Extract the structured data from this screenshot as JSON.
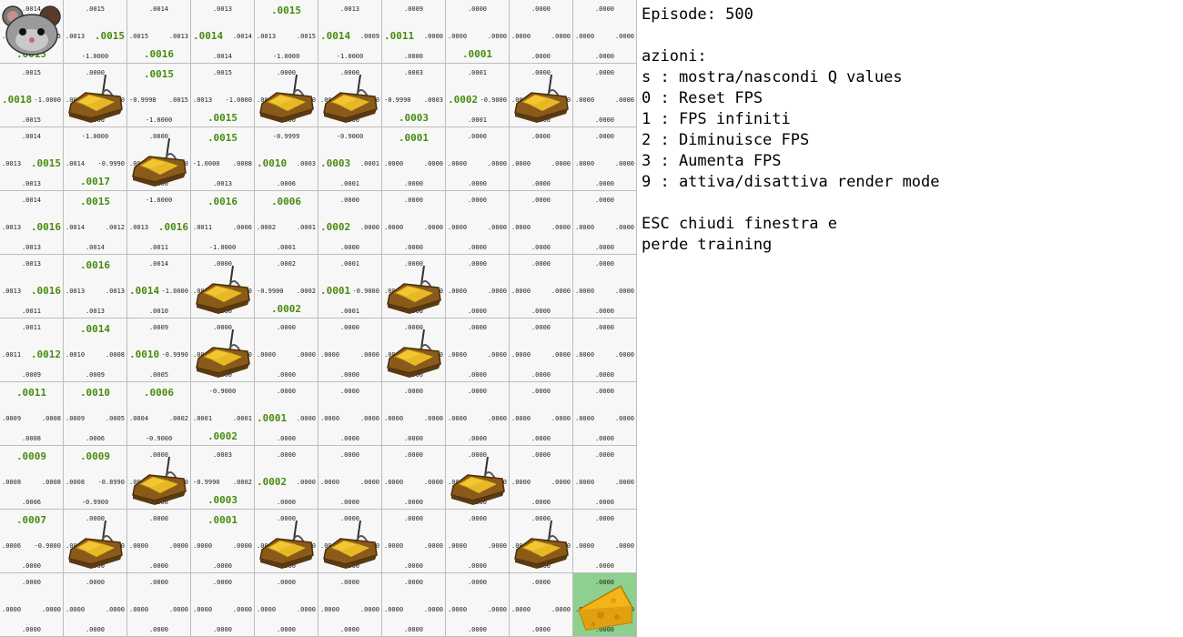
{
  "window": {
    "title": ""
  },
  "grid": {
    "rows": 10,
    "cols": 10,
    "agent": {
      "row": 0,
      "col": 0,
      "icon": "mouse-icon"
    },
    "goal": {
      "row": 9,
      "col": 9,
      "icon": "cheese-icon",
      "color": "#8fd08f"
    },
    "traps": [
      [
        1,
        1
      ],
      [
        1,
        4
      ],
      [
        1,
        5
      ],
      [
        1,
        8
      ],
      [
        2,
        2
      ],
      [
        4,
        3
      ],
      [
        4,
        6
      ],
      [
        5,
        3
      ],
      [
        5,
        6
      ],
      [
        7,
        2
      ],
      [
        7,
        7
      ],
      [
        8,
        1
      ],
      [
        8,
        4
      ],
      [
        8,
        5
      ],
      [
        8,
        8
      ]
    ],
    "trap_icon": "mousetrap-icon",
    "best_color": "#4a8a10",
    "cells": [
      [
        {
          "up": ".0014",
          "left": ".0014",
          "right": ".0015",
          "down": ".0015",
          "best": "down"
        },
        {
          "up": ".0015",
          "left": ".0013",
          "right": ".0015",
          "down": "-1.0000",
          "best": "right"
        },
        {
          "up": ".0014",
          "left": ".0015",
          "right": ".0013",
          "down": ".0016",
          "best": "down"
        },
        {
          "up": ".0013",
          "left": ".0014",
          "right": ".0014",
          "down": ".0014",
          "best": "left"
        },
        {
          "up": ".0015",
          "left": ".0013",
          "right": ".0015",
          "down": "-1.0000",
          "best": "up"
        },
        {
          "up": ".0013",
          "left": ".0014",
          "right": ".0009",
          "down": "-1.0000",
          "best": "left"
        },
        {
          "up": ".0009",
          "left": ".0011",
          "right": ".0000",
          "down": ".0000",
          "best": "left"
        },
        {
          "up": ".0000",
          "left": ".0000",
          "right": ".0000",
          "down": ".0001",
          "best": "down"
        },
        {
          "up": ".0000",
          "left": ".0000",
          "right": ".0000",
          "down": ".0000",
          "best": ""
        },
        {
          "up": ".0000",
          "left": ".0000",
          "right": ".0000",
          "down": ".0000",
          "best": ""
        }
      ],
      [
        {
          "up": ".0015",
          "left": ".0018",
          "right": "-1.0000",
          "down": ".0015",
          "best": "left"
        },
        {
          "up": ".0000",
          "left": ".0000",
          "right": ".0000",
          "down": ".0000",
          "best": ""
        },
        {
          "up": ".0015",
          "left": "-0.9998",
          "right": ".0015",
          "down": "-1.0000",
          "best": "up"
        },
        {
          "up": ".0015",
          "left": ".0013",
          "right": "-1.0000",
          "down": ".0015",
          "best": "down"
        },
        {
          "up": ".0000",
          "left": ".0000",
          "right": ".0000",
          "down": ".0000",
          "best": ""
        },
        {
          "up": ".0000",
          "left": ".0000",
          "right": ".0000",
          "down": ".0000",
          "best": ""
        },
        {
          "up": ".0003",
          "left": "-0.9990",
          "right": ".0003",
          "down": ".0003",
          "best": "down"
        },
        {
          "up": ".0001",
          "left": ".0002",
          "right": "-0.9000",
          "down": ".0001",
          "best": "left"
        },
        {
          "up": ".0000",
          "left": ".0000",
          "right": ".0000",
          "down": ".0000",
          "best": ""
        },
        {
          "up": ".0000",
          "left": ".0000",
          "right": ".0000",
          "down": ".0000",
          "best": ""
        }
      ],
      [
        {
          "up": ".0014",
          "left": ".0013",
          "right": ".0015",
          "down": ".0013",
          "best": "right"
        },
        {
          "up": "-1.0000",
          "left": ".0014",
          "right": "-0.9990",
          "down": ".0017",
          "best": "down"
        },
        {
          "up": ".0000",
          "left": ".0000",
          "right": ".0000",
          "down": ".0000",
          "best": ""
        },
        {
          "up": ".0015",
          "left": "-1.0000",
          "right": ".0008",
          "down": ".0013",
          "best": "up"
        },
        {
          "up": "-0.9999",
          "left": ".0010",
          "right": ".0003",
          "down": ".0006",
          "best": "left"
        },
        {
          "up": "-0.9000",
          "left": ".0003",
          "right": ".0001",
          "down": ".0001",
          "best": "left"
        },
        {
          "up": ".0001",
          "left": ".0000",
          "right": ".0000",
          "down": ".0000",
          "best": "up"
        },
        {
          "up": ".0000",
          "left": ".0000",
          "right": ".0000",
          "down": ".0000",
          "best": ""
        },
        {
          "up": ".0000",
          "left": ".0000",
          "right": ".0000",
          "down": ".0000",
          "best": ""
        },
        {
          "up": ".0000",
          "left": ".0000",
          "right": ".0000",
          "down": ".0000",
          "best": ""
        }
      ],
      [
        {
          "up": ".0014",
          "left": ".0013",
          "right": ".0016",
          "down": ".0013",
          "best": "right"
        },
        {
          "up": ".0015",
          "left": ".0014",
          "right": ".0012",
          "down": ".0014",
          "best": "up"
        },
        {
          "up": "-1.0000",
          "left": ".0013",
          "right": ".0016",
          "down": ".0011",
          "best": "right"
        },
        {
          "up": ".0016",
          "left": ".0011",
          "right": ".0006",
          "down": "-1.0000",
          "best": "up"
        },
        {
          "up": ".0006",
          "left": ".0002",
          "right": ".0001",
          "down": ".0001",
          "best": "up"
        },
        {
          "up": ".0000",
          "left": ".0002",
          "right": ".0000",
          "down": ".0000",
          "best": "left"
        },
        {
          "up": ".0000",
          "left": ".0000",
          "right": ".0000",
          "down": ".0000",
          "best": ""
        },
        {
          "up": ".0000",
          "left": ".0000",
          "right": ".0000",
          "down": ".0000",
          "best": ""
        },
        {
          "up": ".0000",
          "left": ".0000",
          "right": ".0000",
          "down": ".0000",
          "best": ""
        },
        {
          "up": ".0000",
          "left": ".0000",
          "right": ".0000",
          "down": ".0000",
          "best": ""
        }
      ],
      [
        {
          "up": ".0013",
          "left": ".0013",
          "right": ".0016",
          "down": ".0011",
          "best": "right"
        },
        {
          "up": ".0016",
          "left": ".0013",
          "right": ".0013",
          "down": ".0013",
          "best": "up"
        },
        {
          "up": ".0014",
          "left": ".0014",
          "right": "-1.0000",
          "down": ".0010",
          "best": "left"
        },
        {
          "up": ".0000",
          "left": ".0000",
          "right": ".0000",
          "down": ".0000",
          "best": ""
        },
        {
          "up": ".0002",
          "left": "-0.9900",
          "right": ".0002",
          "down": ".0002",
          "best": "down"
        },
        {
          "up": ".0001",
          "left": ".0001",
          "right": "-0.9000",
          "down": ".0001",
          "best": "left"
        },
        {
          "up": ".0000",
          "left": ".0000",
          "right": ".0000",
          "down": ".0000",
          "best": ""
        },
        {
          "up": ".0000",
          "left": ".0000",
          "right": ".0000",
          "down": ".0000",
          "best": ""
        },
        {
          "up": ".0000",
          "left": ".0000",
          "right": ".0000",
          "down": ".0000",
          "best": ""
        },
        {
          "up": ".0000",
          "left": ".0000",
          "right": ".0000",
          "down": ".0000",
          "best": ""
        }
      ],
      [
        {
          "up": ".0011",
          "left": ".0011",
          "right": ".0012",
          "down": ".0009",
          "best": "right"
        },
        {
          "up": ".0014",
          "left": ".0010",
          "right": ".0008",
          "down": ".0009",
          "best": "up"
        },
        {
          "up": ".0009",
          "left": ".0010",
          "right": "-0.9990",
          "down": ".0005",
          "best": "left"
        },
        {
          "up": ".0000",
          "left": ".0000",
          "right": ".0000",
          "down": ".0000",
          "best": ""
        },
        {
          "up": ".0000",
          "left": ".0000",
          "right": ".0000",
          "down": ".0000",
          "best": ""
        },
        {
          "up": ".0000",
          "left": ".0000",
          "right": ".0000",
          "down": ".0000",
          "best": ""
        },
        {
          "up": ".0000",
          "left": ".0000",
          "right": ".0000",
          "down": ".0000",
          "best": ""
        },
        {
          "up": ".0000",
          "left": ".0000",
          "right": ".0000",
          "down": ".0000",
          "best": ""
        },
        {
          "up": ".0000",
          "left": ".0000",
          "right": ".0000",
          "down": ".0000",
          "best": ""
        },
        {
          "up": ".0000",
          "left": ".0000",
          "right": ".0000",
          "down": ".0000",
          "best": ""
        }
      ],
      [
        {
          "up": ".0011",
          "left": ".0009",
          "right": ".0008",
          "down": ".0008",
          "best": "up"
        },
        {
          "up": ".0010",
          "left": ".0009",
          "right": ".0005",
          "down": ".0006",
          "best": "up"
        },
        {
          "up": ".0006",
          "left": ".0004",
          "right": ".0002",
          "down": "-0.9000",
          "best": "up"
        },
        {
          "up": "-0.9000",
          "left": ".0001",
          "right": ".0001",
          "down": ".0002",
          "best": "down"
        },
        {
          "up": ".0000",
          "left": ".0001",
          "right": ".0000",
          "down": ".0000",
          "best": "left"
        },
        {
          "up": ".0000",
          "left": ".0000",
          "right": ".0000",
          "down": ".0000",
          "best": ""
        },
        {
          "up": ".0000",
          "left": ".0000",
          "right": ".0000",
          "down": ".0000",
          "best": ""
        },
        {
          "up": ".0000",
          "left": ".0000",
          "right": ".0000",
          "down": ".0000",
          "best": ""
        },
        {
          "up": ".0000",
          "left": ".0000",
          "right": ".0000",
          "down": ".0000",
          "best": ""
        },
        {
          "up": ".0000",
          "left": ".0000",
          "right": ".0000",
          "down": ".0000",
          "best": ""
        }
      ],
      [
        {
          "up": ".0009",
          "left": ".0008",
          "right": ".0008",
          "down": ".0006",
          "best": "up"
        },
        {
          "up": ".0009",
          "left": ".0008",
          "right": "-0.8990",
          "down": "-0.9900",
          "best": "up"
        },
        {
          "up": ".0000",
          "left": ".0000",
          "right": ".0000",
          "down": ".0000",
          "best": ""
        },
        {
          "up": ".0003",
          "left": "-0.9990",
          "right": ".0002",
          "down": ".0003",
          "best": "down"
        },
        {
          "up": ".0000",
          "left": ".0002",
          "right": ".0000",
          "down": ".0000",
          "best": "left"
        },
        {
          "up": ".0000",
          "left": ".0000",
          "right": ".0000",
          "down": ".0000",
          "best": ""
        },
        {
          "up": ".0000",
          "left": ".0000",
          "right": ".0000",
          "down": ".0000",
          "best": ""
        },
        {
          "up": ".0000",
          "left": ".0000",
          "right": ".0000",
          "down": ".0000",
          "best": ""
        },
        {
          "up": ".0000",
          "left": ".0000",
          "right": ".0000",
          "down": ".0000",
          "best": ""
        },
        {
          "up": ".0000",
          "left": ".0000",
          "right": ".0000",
          "down": ".0000",
          "best": ""
        }
      ],
      [
        {
          "up": ".0007",
          "left": ".0006",
          "right": "-0.9000",
          "down": ".0000",
          "best": "up"
        },
        {
          "up": ".0000",
          "left": ".0000",
          "right": ".0000",
          "down": ".0000",
          "best": ""
        },
        {
          "up": ".0000",
          "left": ".0000",
          "right": ".0000",
          "down": ".0000",
          "best": ""
        },
        {
          "up": ".0001",
          "left": ".0000",
          "right": ".0000",
          "down": ".0000",
          "best": "up"
        },
        {
          "up": ".0000",
          "left": ".0000",
          "right": ".0000",
          "down": ".0000",
          "best": ""
        },
        {
          "up": ".0000",
          "left": ".0000",
          "right": ".0000",
          "down": ".0000",
          "best": ""
        },
        {
          "up": ".0000",
          "left": ".0000",
          "right": ".0000",
          "down": ".0000",
          "best": ""
        },
        {
          "up": ".0000",
          "left": ".0000",
          "right": ".0000",
          "down": ".0000",
          "best": ""
        },
        {
          "up": ".0000",
          "left": ".0000",
          "right": ".0000",
          "down": ".0000",
          "best": ""
        },
        {
          "up": ".0000",
          "left": ".0000",
          "right": ".0000",
          "down": ".0000",
          "best": ""
        }
      ],
      [
        {
          "up": ".0000",
          "left": ".0000",
          "right": ".0000",
          "down": ".0000",
          "best": ""
        },
        {
          "up": ".0000",
          "left": ".0000",
          "right": ".0000",
          "down": ".0000",
          "best": ""
        },
        {
          "up": ".0000",
          "left": ".0000",
          "right": ".0000",
          "down": ".0000",
          "best": ""
        },
        {
          "up": ".0000",
          "left": ".0000",
          "right": ".0000",
          "down": ".0000",
          "best": ""
        },
        {
          "up": ".0000",
          "left": ".0000",
          "right": ".0000",
          "down": ".0000",
          "best": ""
        },
        {
          "up": ".0000",
          "left": ".0000",
          "right": ".0000",
          "down": ".0000",
          "best": ""
        },
        {
          "up": ".0000",
          "left": ".0000",
          "right": ".0000",
          "down": ".0000",
          "best": ""
        },
        {
          "up": ".0000",
          "left": ".0000",
          "right": ".0000",
          "down": ".0000",
          "best": ""
        },
        {
          "up": ".0000",
          "left": ".0000",
          "right": ".0000",
          "down": ".0000",
          "best": ""
        },
        {
          "up": ".0000",
          "left": ".0000",
          "right": ".0000",
          "down": ".0000",
          "best": ""
        }
      ]
    ]
  },
  "panel": {
    "episode": "Episode: 500",
    "actions_title": "azioni:",
    "actions": [
      "s : mostra/nascondi Q values",
      "0 : Reset FPS",
      "1 : FPS infiniti",
      "2 : Diminuisce FPS",
      "3 : Aumenta FPS",
      "9 : attiva/disattiva render mode"
    ],
    "esc_line1": "ESC chiudi finestra e",
    "esc_line2": "perde training"
  }
}
